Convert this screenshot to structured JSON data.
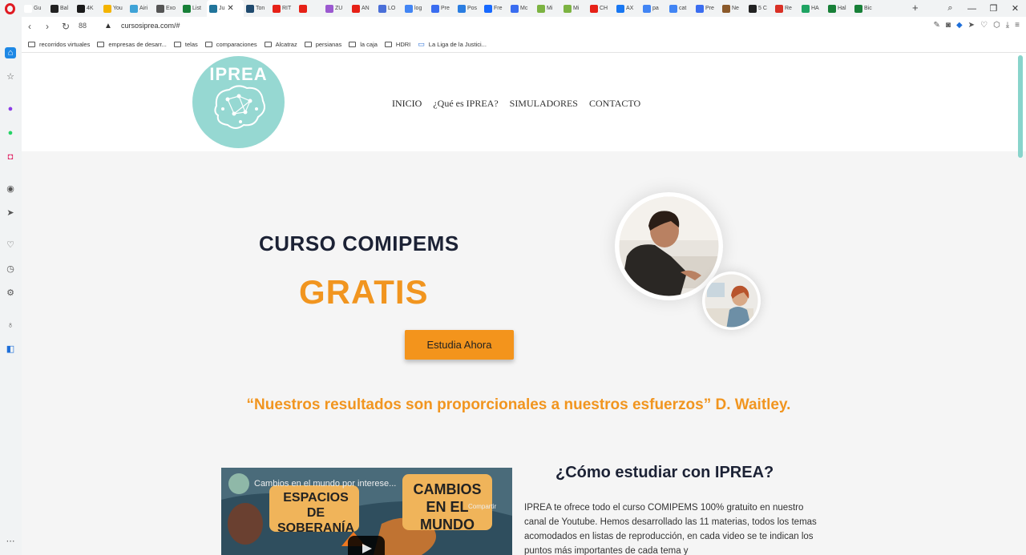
{
  "browser": {
    "tabs": [
      {
        "label": "Gu",
        "color": "#ffffff"
      },
      {
        "label": "Bal",
        "color": "#222222"
      },
      {
        "label": "4K",
        "color": "#1a1a1a"
      },
      {
        "label": "You",
        "color": "#f4b400"
      },
      {
        "label": "Airi",
        "color": "#3fa3d7"
      },
      {
        "label": "Exo",
        "color": "#555555"
      },
      {
        "label": "List",
        "color": "#188038"
      },
      {
        "label": "Ju",
        "color": "#21759b",
        "active": true
      },
      {
        "label": "Ton",
        "color": "#1f4a6e"
      },
      {
        "label": "RIT",
        "color": "#e62117"
      },
      {
        "label": "",
        "color": "#e62117"
      },
      {
        "label": "ZU",
        "color": "#9b59d0"
      },
      {
        "label": "AN",
        "color": "#e62117"
      },
      {
        "label": "LO",
        "color": "#4a6fd8"
      },
      {
        "label": "log",
        "color": "#4285f4"
      },
      {
        "label": "Pre",
        "color": "#3a6df0"
      },
      {
        "label": "Pos",
        "color": "#2a7de1"
      },
      {
        "label": "Fre",
        "color": "#1769ff"
      },
      {
        "label": "Mc",
        "color": "#3a6df0"
      },
      {
        "label": "Mi",
        "color": "#7cb342"
      },
      {
        "label": "Mi",
        "color": "#7cb342"
      },
      {
        "label": "CH",
        "color": "#e62117"
      },
      {
        "label": "AX",
        "color": "#1877f2"
      },
      {
        "label": "pa",
        "color": "#4285f4"
      },
      {
        "label": "cat",
        "color": "#4285f4"
      },
      {
        "label": "Pre",
        "color": "#3a6df0"
      },
      {
        "label": "Ne",
        "color": "#8b5a2b"
      },
      {
        "label": "5 C",
        "color": "#222222"
      },
      {
        "label": "Re",
        "color": "#d93025"
      },
      {
        "label": "HA",
        "color": "#1fa463"
      },
      {
        "label": "Hal",
        "color": "#188038"
      },
      {
        "label": "Bic",
        "color": "#188038"
      }
    ],
    "active_tab_close": "✕",
    "new_tab": "+",
    "window_controls": {
      "search": "⌕",
      "minimize": "—",
      "restore": "❐",
      "close": "✕"
    },
    "nav": {
      "back": "‹",
      "forward": "›",
      "reload": "↻",
      "tabs_grid": "88"
    },
    "url": "cursosiprea.com/#",
    "bookmarks": [
      "recorridos virtuales",
      "empresas de desarr...",
      "telas",
      "comparaciones",
      "Alcatraz",
      "persianas",
      "la caja",
      "HDRI",
      "La Liga de la Justici..."
    ]
  },
  "site": {
    "logo": "IPREA",
    "nav": [
      "INICIO",
      "¿Qué es IPREA?",
      "SIMULADORES",
      "CONTACTO"
    ],
    "hero_title": "CURSO COMIPEMS",
    "hero_highlight": "GRATIS",
    "cta": "Estudia Ahora",
    "quote": "“Nuestros resultados son proporcionales a nuestros esfuerzos” D. Waitley.",
    "video": {
      "title": "Cambios en el mundo por interese...",
      "share": "Compartir",
      "sign1": "ESPACIOS DE SOBERANÍA",
      "sign2": "CAMBIOS EN EL MUNDO"
    },
    "how_title": "¿Cómo estudiar con IPREA?",
    "how_body": "IPREA te ofrece todo el curso COMIPEMS 100% gratuito en nuestro canal de Youtube. Hemos desarrollado las 11 materias, todos los temas acomodados en listas de reproducción, en cada video se te indican los puntos más importantes de cada tema y"
  },
  "colors": {
    "accent": "#f1951f",
    "logo": "#96d8d2",
    "heading": "#1c2235"
  }
}
